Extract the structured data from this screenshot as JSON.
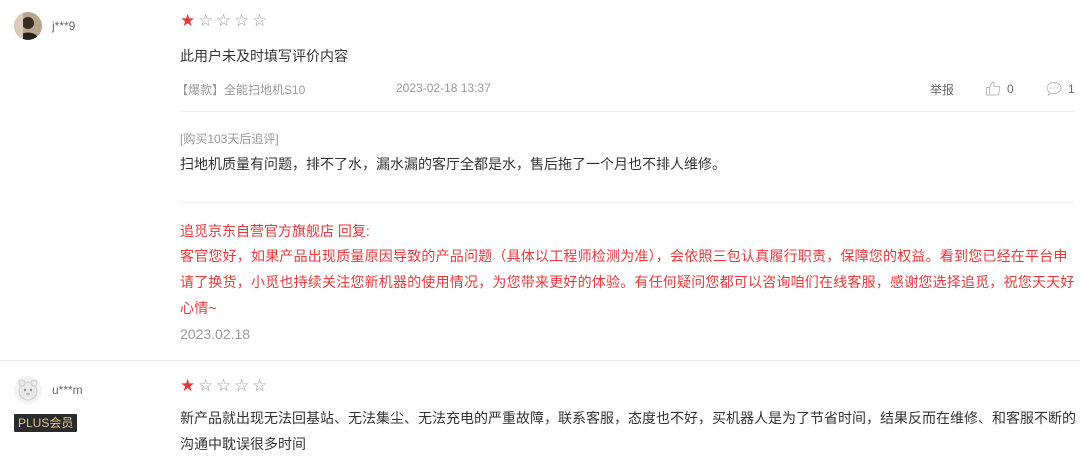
{
  "reviews": [
    {
      "username": "j***9",
      "rating": 1,
      "max_rating": 5,
      "content": "此用户未及时填写评价内容",
      "product": "【爆款】全能扫地机S10",
      "date": "2023-02-18 13:37",
      "report_label": "举报",
      "likes": "0",
      "comments": "1",
      "followup_tag": "[购买103天后追评]",
      "followup_text": "扫地机质量有问题，排不了水，漏水漏的客厅全都是水，售后拖了一个月也不排人维修。",
      "reply_header": "追觅京东自营官方旗舰店 回复:",
      "reply_text": "客官您好，如果产品出现质量原因导致的产品问题（具体以工程师检测为准），会依照三包认真履行职责，保障您的权益。看到您已经在平台申请了换货，小觅也持续关注您新机器的使用情况，为您带来更好的体验。有任何疑问您都可以咨询咱们在线客服，感谢您选择追觅，祝您天天好心情~",
      "reply_date": "2023.02.18"
    },
    {
      "username": "u***m",
      "badge": "PLUS会员",
      "rating": 1,
      "max_rating": 5,
      "content": "新产品就出现无法回基站、无法集尘、无法充电的严重故障，联系客服，态度也不好，买机器人是为了节省时间，结果反而在维修、和客服不断的沟通中耽误很多时间"
    }
  ],
  "icons": {
    "like": "thumbs-up-icon",
    "comment": "speech-bubble-icon",
    "star_filled": "star-filled-icon",
    "star_empty": "star-outline-icon"
  },
  "colors": {
    "accent": "#e4393c",
    "muted": "#999999",
    "badge_bg": "#2b2b2b",
    "badge_text": "#e7c48c"
  }
}
